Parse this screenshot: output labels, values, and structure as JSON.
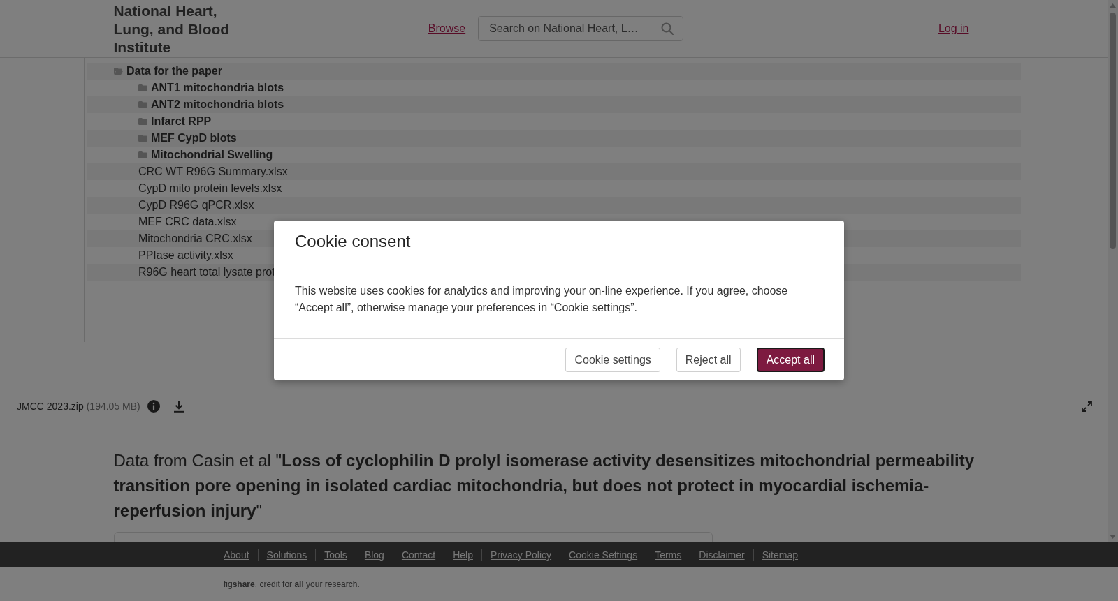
{
  "header": {
    "logo": "National Heart, Lung, and Blood Institute",
    "nav_link": "Browse",
    "search": {
      "placeholder": "Search on National Heart, L…"
    },
    "login": "Log in"
  },
  "tree": [
    {
      "kind": "folder",
      "label": "Data for the paper",
      "expanded": true,
      "children": [
        {
          "kind": "folder",
          "label": "ANT1 mitochondria blots",
          "expanded": false
        },
        {
          "kind": "folder",
          "label": "ANT2 mitochondria blots",
          "expanded": false
        },
        {
          "kind": "folder",
          "label": "Infarct RPP",
          "expanded": false
        },
        {
          "kind": "folder",
          "label": "MEF CypD blots",
          "expanded": false
        },
        {
          "kind": "folder",
          "label": "Mitochondrial Swelling",
          "expanded": false
        },
        {
          "kind": "file",
          "label": "CRC WT R96G Summary.xlsx"
        },
        {
          "kind": "file",
          "label": "CypD mito protein levels.xlsx"
        },
        {
          "kind": "file",
          "label": "CypD R96G qPCR.xlsx"
        },
        {
          "kind": "file",
          "label": "MEF CRC data.xlsx"
        },
        {
          "kind": "file",
          "label": "Mitochondria CRC.xlsx"
        },
        {
          "kind": "file",
          "label": "PPIase activity.xlsx"
        },
        {
          "kind": "file",
          "label": "R96G heart total lysate prot"
        }
      ]
    }
  ],
  "file_bar": {
    "name": "JMCC 2023.zip",
    "size": "(194.05 MB)"
  },
  "title": "Data from Casin et al \"**Loss of cyclophilin D prolyl isomerase activity desensitizes mitochondrial permeability transition pore opening in isolated cardiac mitochondria, but does not protect in myocardial ischemia-reperfusion injury**\"",
  "footer": {
    "links": [
      "About",
      "Solutions",
      "Tools",
      "Blog",
      "Contact",
      "Help",
      "Privacy Policy",
      "Cookie Settings",
      "Terms",
      "Disclaimer",
      "Sitemap"
    ],
    "tagline": "fig**share**. credit for **all** your research."
  },
  "cookie_dialog": {
    "title": "Cookie consent",
    "message": "This website uses cookies for analytics and improving your on-line experience. If you agree, choose “Accept all”, otherwise manage your preferences in “Cookie settings”.",
    "buttons": [
      {
        "label": "Cookie settings",
        "kind": "secondary"
      },
      {
        "label": "Reject all",
        "kind": "secondary"
      },
      {
        "label": "Accept all",
        "kind": "primary"
      }
    ]
  }
}
